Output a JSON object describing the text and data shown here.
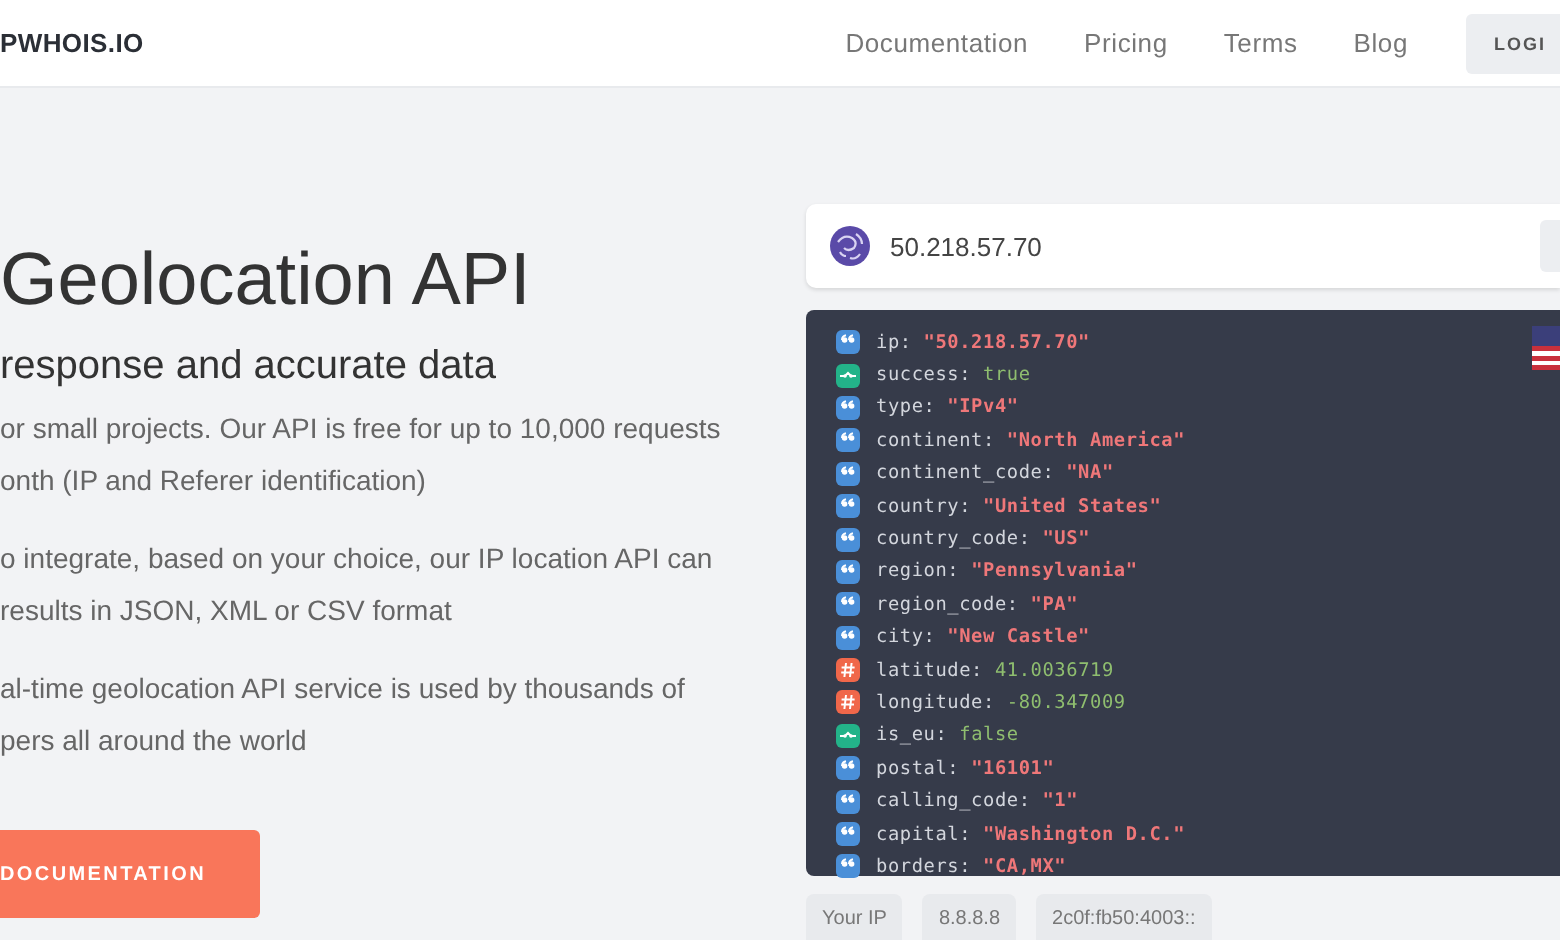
{
  "header": {
    "logo": "PWHOIS.IO",
    "nav": [
      "Documentation",
      "Pricing",
      "Terms",
      "Blog"
    ],
    "login": "LOGI"
  },
  "hero": {
    "title": "Geolocation API",
    "subtitle": "response and accurate data",
    "paragraphs": [
      [
        "or small projects. Our API is free for up to 10,000 requests",
        "onth (IP and Referer identification)"
      ],
      [
        "o integrate, based on your choice, our IP location API can",
        "results in JSON, XML or CSV format"
      ],
      [
        "al-time geolocation API service is used by thousands of",
        "pers all around the world"
      ]
    ],
    "button": "DOCUMENTATION"
  },
  "lookup": {
    "query": "50.218.57.70",
    "fields": [
      {
        "key": "ip:",
        "value": "\"50.218.57.70\"",
        "kind": "string"
      },
      {
        "key": "success:",
        "value": "true",
        "kind": "boolean"
      },
      {
        "key": "type:",
        "value": "\"IPv4\"",
        "kind": "string"
      },
      {
        "key": "continent:",
        "value": "\"North America\"",
        "kind": "string"
      },
      {
        "key": "continent_code:",
        "value": "\"NA\"",
        "kind": "string"
      },
      {
        "key": "country:",
        "value": "\"United States\"",
        "kind": "string"
      },
      {
        "key": "country_code:",
        "value": "\"US\"",
        "kind": "string"
      },
      {
        "key": "region:",
        "value": "\"Pennsylvania\"",
        "kind": "string"
      },
      {
        "key": "region_code:",
        "value": "\"PA\"",
        "kind": "string"
      },
      {
        "key": "city:",
        "value": "\"New Castle\"",
        "kind": "string"
      },
      {
        "key": "latitude:",
        "value": "41.0036719",
        "kind": "number"
      },
      {
        "key": "longitude:",
        "value": "-80.347009",
        "kind": "number"
      },
      {
        "key": "is_eu:",
        "value": "false",
        "kind": "boolean"
      },
      {
        "key": "postal:",
        "value": "\"16101\"",
        "kind": "string"
      },
      {
        "key": "calling_code:",
        "value": "\"1\"",
        "kind": "string"
      },
      {
        "key": "capital:",
        "value": "\"Washington D.C.\"",
        "kind": "string"
      },
      {
        "key": "borders:",
        "value": "\"CA,MX\"",
        "kind": "string"
      }
    ],
    "quick_ips": [
      "Your IP",
      "8.8.8.8",
      "2c0f:fb50:4003::"
    ]
  }
}
